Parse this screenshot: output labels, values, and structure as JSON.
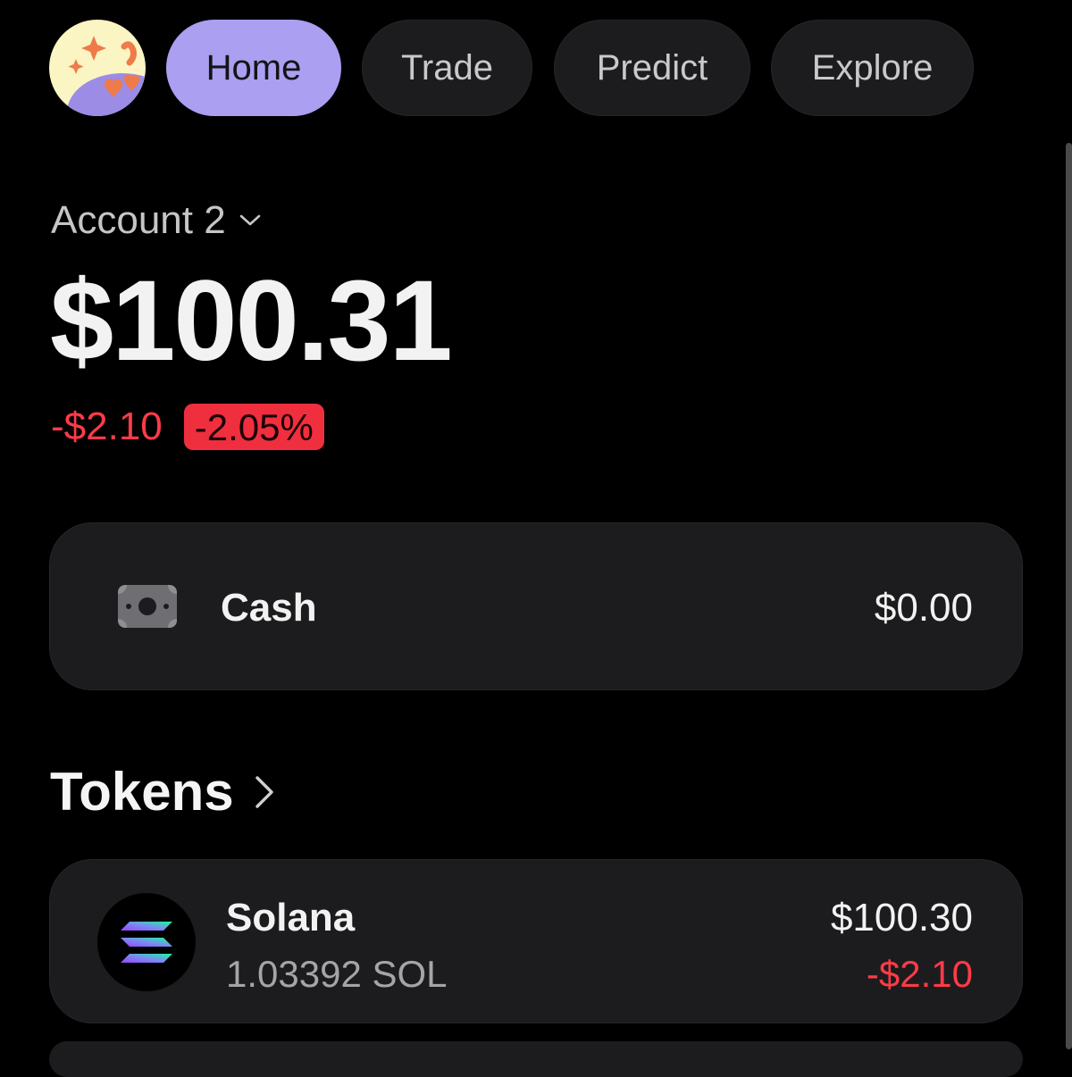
{
  "nav": {
    "tabs": [
      {
        "label": "Home",
        "active": true
      },
      {
        "label": "Trade",
        "active": false
      },
      {
        "label": "Predict",
        "active": false
      },
      {
        "label": "Explore",
        "active": false
      }
    ],
    "avatar_icon": "heart-eyes-emoji-avatar-icon"
  },
  "account": {
    "name": "Account 2",
    "dropdown_icon": "chevron-down-icon",
    "balance": "$100.31",
    "change_value": "-$2.10",
    "change_percent": "-2.05%"
  },
  "cash": {
    "icon": "banknote-icon",
    "label": "Cash",
    "value": "$0.00"
  },
  "tokens": {
    "title": "Tokens",
    "arrow_icon": "chevron-right-icon",
    "items": [
      {
        "name": "Solana",
        "amount": "1.03392 SOL",
        "value": "$100.30",
        "change": "-$2.10",
        "icon": "solana-logo-icon"
      }
    ]
  },
  "colors": {
    "background": "#000000",
    "card": "#1c1c1e",
    "accent": "#ab9ff2",
    "negative": "#ff3b47",
    "badge_negative": "#ef2f3e"
  }
}
